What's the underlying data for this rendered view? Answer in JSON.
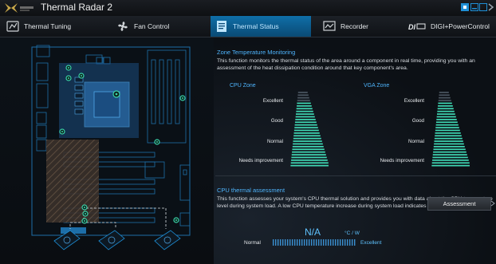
{
  "app": {
    "title": "Thermal Radar 2",
    "brand": "TUF"
  },
  "tabs": [
    {
      "label": "Thermal Tuning",
      "icon": "tuning-icon",
      "active": false
    },
    {
      "label": "Fan Control",
      "icon": "fan-icon",
      "active": false
    },
    {
      "label": "Thermal Status",
      "icon": "status-icon",
      "active": true
    },
    {
      "label": "Recorder",
      "icon": "recorder-icon",
      "active": false
    },
    {
      "label": "DIGI+PowerControl",
      "icon": "digi-icon",
      "active": false
    }
  ],
  "zone_monitoring": {
    "title": "Zone Temperature Monitoring",
    "description": "This function monitors the thermal status of the area around a component in real time, providing you with an assessment of the heat dissipation condition around that key component's area.",
    "cpu_zone": {
      "label": "CPU Zone"
    },
    "vga_zone": {
      "label": "VGA Zone"
    },
    "levels": [
      "Excellent",
      "Good",
      "Normal",
      "Needs improvement"
    ]
  },
  "assessment": {
    "title": "CPU thermal assessment",
    "description": "This function assesses your system's CPU thermal solution and provides you with data about the CPU temperature level during system load. A low CPU temperature increase during system load indicates a better thermal solution.",
    "value": "N/A",
    "unit": "°C / W",
    "scale_low": "Normal",
    "scale_high": "Excellent",
    "button_label": "Assessment"
  },
  "colors": {
    "accent": "#1f8fd6",
    "bar": "#3fd8b4",
    "sensor": "#39d2a8"
  }
}
